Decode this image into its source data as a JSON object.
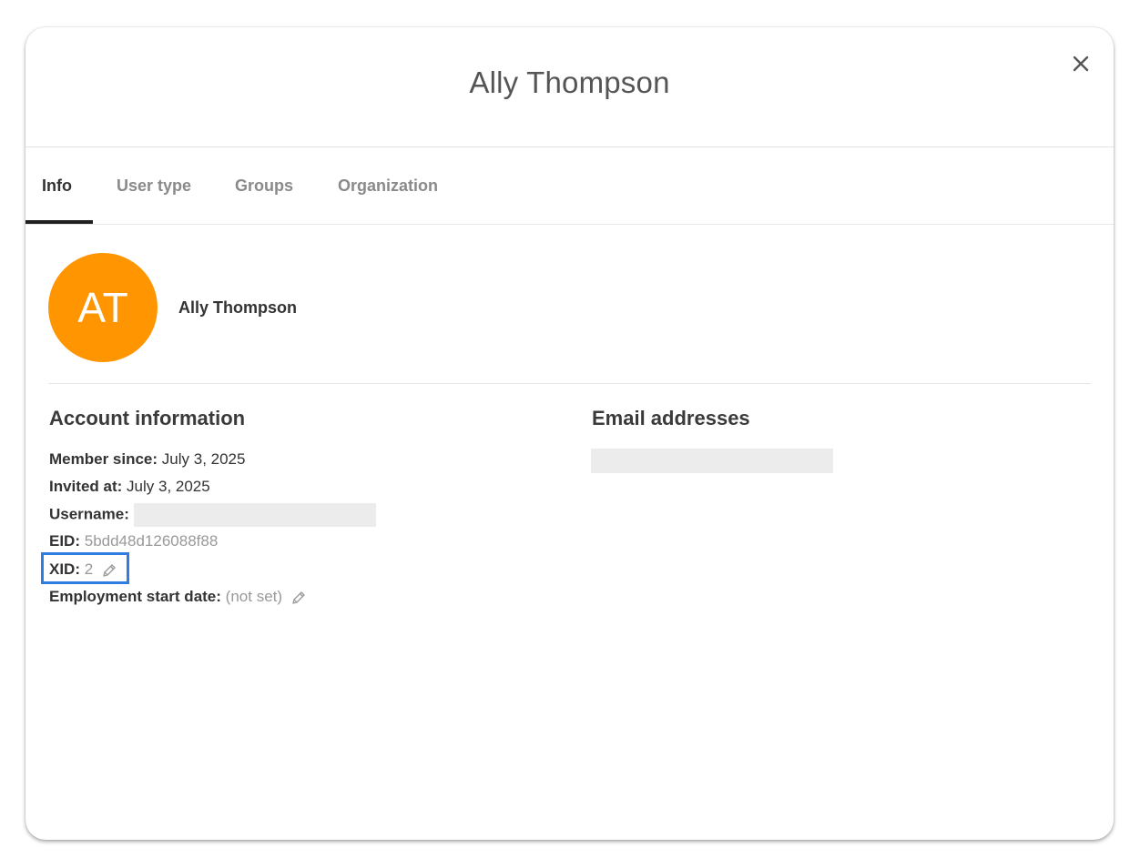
{
  "header": {
    "title": "Ally Thompson"
  },
  "tabs": [
    {
      "label": "Info",
      "active": true
    },
    {
      "label": "User type",
      "active": false
    },
    {
      "label": "Groups",
      "active": false
    },
    {
      "label": "Organization",
      "active": false
    }
  ],
  "profile": {
    "initials": "AT",
    "avatar_color": "#ff9500",
    "name": "Ally Thompson"
  },
  "account_information": {
    "title": "Account information",
    "member_since_label": "Member since:",
    "member_since_value": "July 3, 2025",
    "invited_at_label": "Invited at:",
    "invited_at_value": "July 3, 2025",
    "username_label": "Username:",
    "eid_label": "EID:",
    "eid_value": "5bdd48d126088f88",
    "xid_label": "XID:",
    "xid_value": "2",
    "employment_start_label": "Employment start date:",
    "employment_start_value": "(not set)"
  },
  "email_addresses": {
    "title": "Email addresses"
  },
  "icons": {
    "close": "close-icon",
    "edit": "pencil-icon"
  },
  "colors": {
    "highlight": "#2f7de1",
    "tab_underline": "#1f1f1f"
  }
}
